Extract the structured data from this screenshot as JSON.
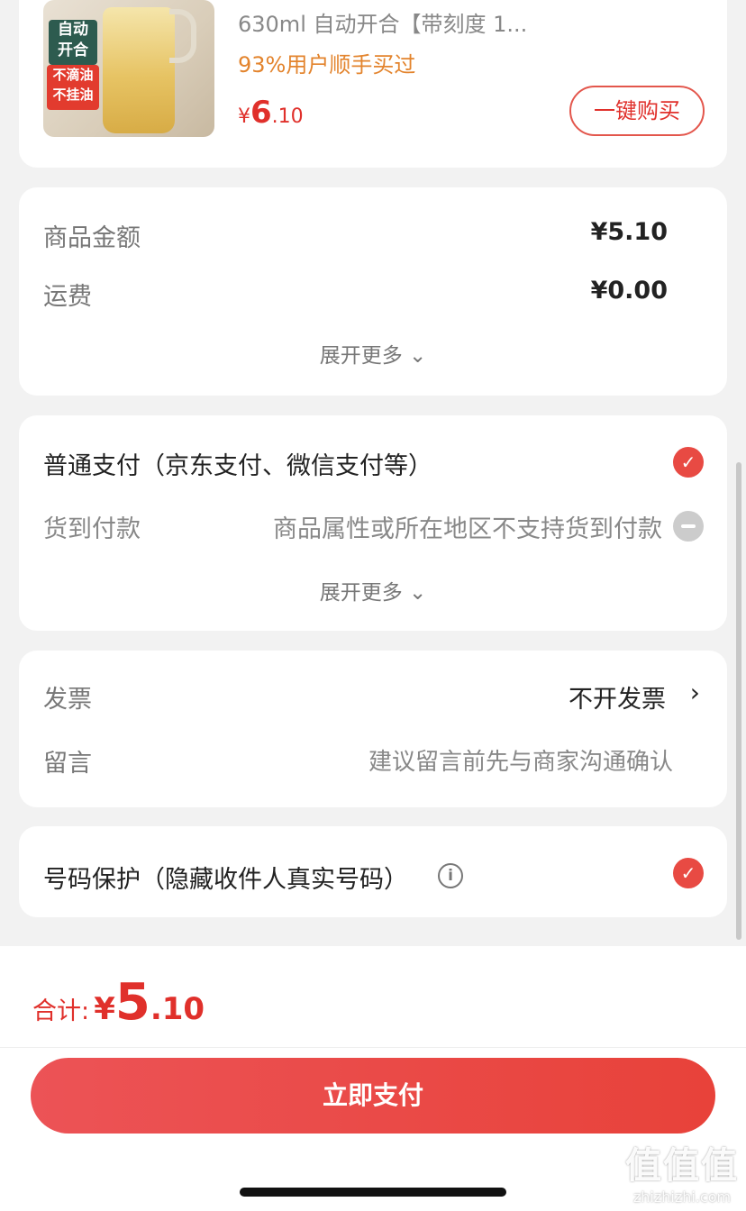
{
  "product": {
    "thumb_tag_dark_1": "自动",
    "thumb_tag_dark_2": "开合",
    "thumb_tag_red_1": "不滴油",
    "thumb_tag_red_2": "不挂油",
    "title": "630ml 自动开合【带刻度  1...",
    "bought": "93%用户顺手买过",
    "price_currency": "¥",
    "price_int": "6",
    "price_dec": ".10",
    "buy_label": "一键购买"
  },
  "amount": {
    "goods_label": "商品金额",
    "goods_value": "¥5.10",
    "shipping_label": "运费",
    "shipping_value": "¥0.00",
    "expand_label": "展开更多 ⌄"
  },
  "payment": {
    "normal_label": "普通支付（京东支付、微信支付等）",
    "cod_label": "货到付款",
    "cod_note": "商品属性或所在地区不支持货到付款",
    "expand_label": "展开更多 ⌄",
    "check_glyph": "✓"
  },
  "invoice": {
    "label": "发票",
    "value": "不开发票",
    "chevron": "›",
    "message_label": "留言",
    "message_placeholder": "建议留言前先与商家沟通确认"
  },
  "privacy": {
    "label": "号码保护（隐藏收件人真实号码）",
    "info_glyph": "i",
    "check_glyph": "✓"
  },
  "footer": {
    "total_label": "合计:",
    "total_currency": "¥",
    "total_int": "5",
    "total_dec": ".10",
    "pay_label": "立即支付"
  },
  "watermark": {
    "line1": "值值值",
    "line2": "zhizhizhi.com"
  },
  "colors": {
    "accent": "#e0302b",
    "orange": "#e3842d",
    "background": "#f2f2f2"
  }
}
